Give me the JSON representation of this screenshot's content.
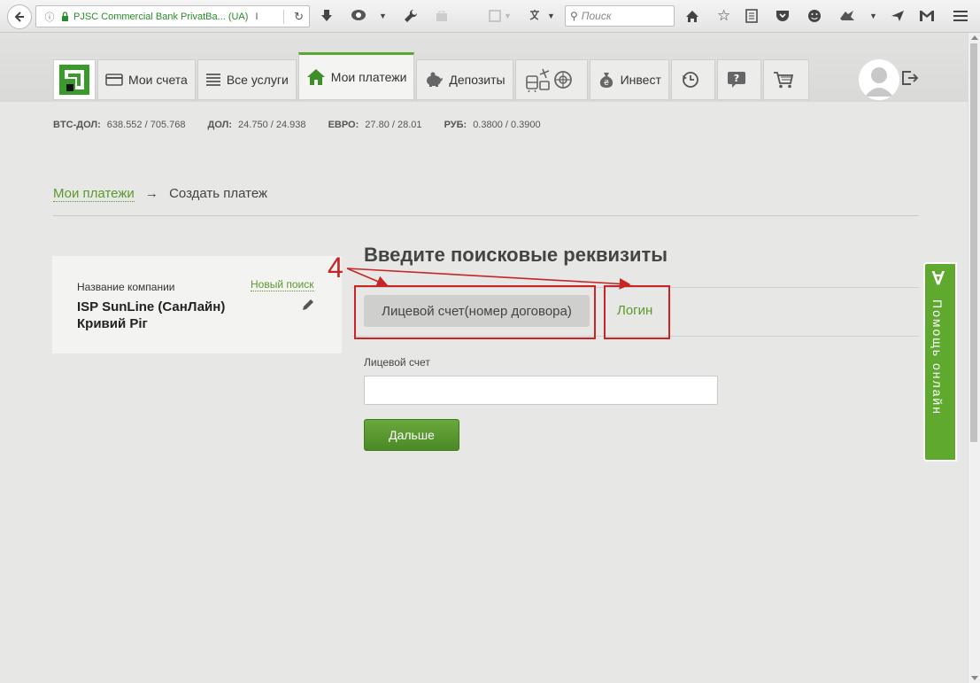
{
  "browser": {
    "url_site": "PJSC Commercial Bank PrivatBa... (UA)",
    "url_text": "I",
    "search_placeholder": "Поиск"
  },
  "nav": {
    "tabs": [
      {
        "label": "Мои счета",
        "icon": "card-icon"
      },
      {
        "label": "Все услуги",
        "icon": "list-icon"
      },
      {
        "label": "Мои платежи",
        "icon": "home-icon",
        "active": true
      },
      {
        "label": "Депозиты",
        "icon": "piggy-bank-icon"
      },
      {
        "label": "",
        "icon": "transport-icon"
      },
      {
        "label": "Инвест",
        "icon": "money-bag-icon"
      },
      {
        "label": "",
        "icon": "history-icon"
      },
      {
        "label": "",
        "icon": "help-icon"
      },
      {
        "label": "",
        "icon": "cart-icon"
      }
    ]
  },
  "rates": [
    {
      "label": "BTC-ДОЛ:",
      "value": "638.552 / 705.768"
    },
    {
      "label": "ДОЛ:",
      "value": "24.750 / 24.938"
    },
    {
      "label": "ЕВРО:",
      "value": "27.80 / 28.01"
    },
    {
      "label": "РУБ:",
      "value": "0.3800 / 0.3900"
    }
  ],
  "breadcrumb": {
    "link": "Мои платежи",
    "arrow": "→",
    "current": "Создать платеж"
  },
  "company": {
    "label": "Название компании",
    "new_search": "Новый поиск",
    "name": "ISP SunLine (СанЛайн) Кривий Ріг"
  },
  "form": {
    "title": "Введите поисковые реквизиты",
    "tab_account": "Лицевой счет(номер договора)",
    "tab_login": "Логин",
    "field_label": "Лицевой счет",
    "field_value": "",
    "submit": "Дальше"
  },
  "annotation": {
    "number": "4",
    "color": "#c92525"
  },
  "help": {
    "label": "Помощь онлайн",
    "symbol": "∀"
  },
  "colors": {
    "accent": "#5ca535",
    "link": "#5a9a2c"
  }
}
